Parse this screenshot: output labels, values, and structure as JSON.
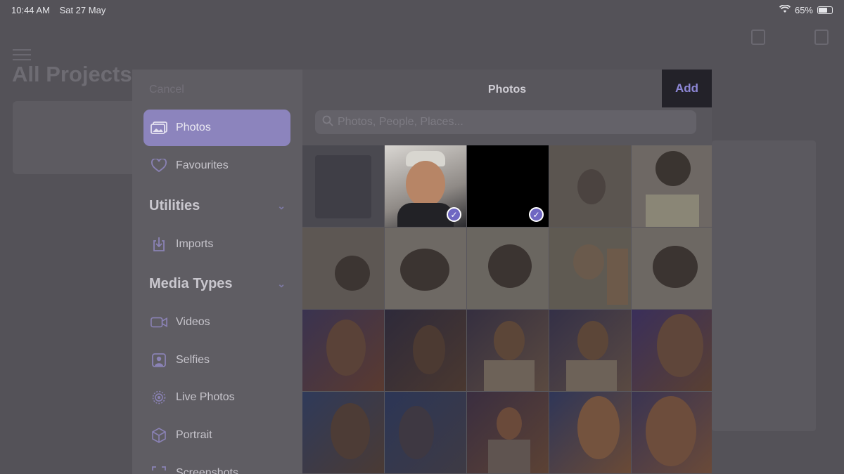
{
  "status": {
    "time": "10:44 AM",
    "date": "Sat 27 May",
    "battery": "65%"
  },
  "background": {
    "title": "All Projects"
  },
  "picker": {
    "cancel_label": "Cancel",
    "title": "Photos",
    "add_label": "Add",
    "search_placeholder": "Photos, People, Places...",
    "sidebar": {
      "photos": "Photos",
      "favourites": "Favourites",
      "utilities_heading": "Utilities",
      "imports": "Imports",
      "media_types_heading": "Media Types",
      "videos": "Videos",
      "selfies": "Selfies",
      "live_photos": "Live Photos",
      "portrait": "Portrait",
      "screenshots": "Screenshots"
    },
    "selected_photo_count": 2
  },
  "colors": {
    "accent": "#8c84bd",
    "add_text": "#8d87d6",
    "check": "#6f67c2"
  }
}
